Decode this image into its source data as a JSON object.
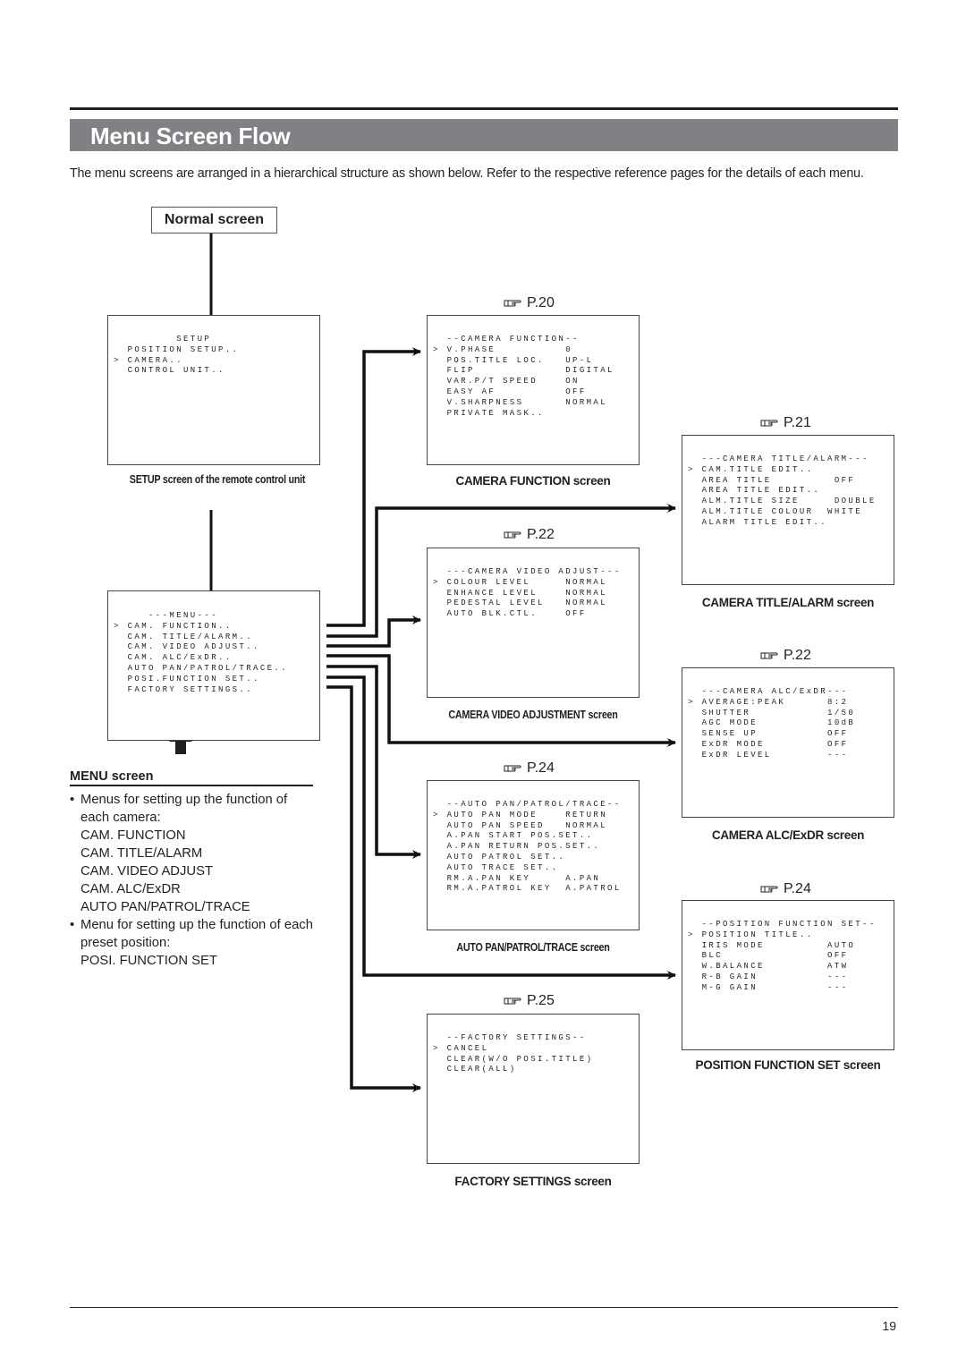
{
  "page": {
    "title": "Menu Screen Flow",
    "intro": "The menu screens are arranged in a hierarchical structure as shown below. Refer to the respective reference pages for the details of each menu.",
    "page_number": "19"
  },
  "normal_screen": {
    "label": "Normal screen"
  },
  "screens": {
    "setup": {
      "caption": "SETUP screen of the remote control unit",
      "text": "         SETUP\n  POSITION SETUP..\n> CAMERA..\n  CONTROL UNIT.."
    },
    "menu": {
      "text": "     ---MENU---\n> CAM. FUNCTION..\n  CAM. TITLE/ALARM..\n  CAM. VIDEO ADJUST..\n  CAM. ALC/ExDR..\n  AUTO PAN/PATROL/TRACE..\n  POSI.FUNCTION SET..\n  FACTORY SETTINGS.."
    },
    "camera_function": {
      "ref": "P.20",
      "caption": "CAMERA FUNCTION screen",
      "text": "  --CAMERA FUNCTION--\n> V.PHASE          0\n  POS.TITLE LOC.   UP-L\n  FLIP             DIGITAL\n  VAR.P/T SPEED    ON\n  EASY AF          OFF\n  V.SHARPNESS      NORMAL\n  PRIVATE MASK.."
    },
    "camera_title_alarm": {
      "ref": "P.21",
      "caption": "CAMERA TITLE/ALARM screen",
      "text": "  ---CAMERA TITLE/ALARM---\n> CAM.TITLE EDIT..\n  AREA TITLE         OFF\n  AREA TITLE EDIT..\n  ALM.TITLE SIZE     DOUBLE\n  ALM.TITLE COLOUR  WHITE\n  ALARM TITLE EDIT.."
    },
    "camera_video_adjust": {
      "ref": "P.22",
      "caption": "CAMERA VIDEO ADJUSTMENT screen",
      "text": "  ---CAMERA VIDEO ADJUST---\n> COLOUR LEVEL     NORMAL\n  ENHANCE LEVEL    NORMAL\n  PEDESTAL LEVEL   NORMAL\n  AUTO BLK.CTL.    OFF"
    },
    "camera_alc_exdr": {
      "ref": "P.22",
      "caption": "CAMERA ALC/ExDR screen",
      "text": "  ---CAMERA ALC/ExDR---\n> AVERAGE:PEAK      8:2\n  SHUTTER           1/50\n  AGC MODE          10dB\n  SENSE UP          OFF\n  ExDR MODE         OFF\n  ExDR LEVEL        ---"
    },
    "auto_pan_patrol_trace": {
      "ref": "P.24",
      "caption": "AUTO PAN/PATROL/TRACE screen",
      "text": "  --AUTO PAN/PATROL/TRACE--\n> AUTO PAN MODE    RETURN\n  AUTO PAN SPEED   NORMAL\n  A.PAN START POS.SET..\n  A.PAN RETURN POS.SET..\n  AUTO PATROL SET..\n  AUTO TRACE SET..\n  RM.A.PAN KEY     A.PAN\n  RM.A.PATROL KEY  A.PATROL"
    },
    "position_function_set": {
      "ref": "P.24",
      "caption": "POSITION FUNCTION SET screen",
      "text": "  --POSITION FUNCTION SET--\n> POSITION TITLE..\n  IRIS MODE         AUTO\n  BLC               OFF\n  W.BALANCE         ATW\n  R-B GAIN          ---\n  M-G GAIN          ---"
    },
    "factory_settings": {
      "ref": "P.25",
      "caption": "FACTORY SETTINGS screen",
      "text": "  --FACTORY SETTINGS--\n> CANCEL\n  CLEAR(W/O POSI.TITLE)\n  CLEAR(ALL)"
    }
  },
  "menu_description": {
    "heading": "MENU screen",
    "bullet1": "Menus for setting up the function of each camera:",
    "camera_items": [
      "CAM. FUNCTION",
      "CAM. TITLE/ALARM",
      "CAM. VIDEO ADJUST",
      "CAM. ALC/ExDR",
      "AUTO PAN/PATROL/TRACE"
    ],
    "bullet2": "Menu for setting up the function of each preset position:",
    "position_items": [
      "POSI. FUNCTION SET"
    ]
  },
  "icons": {
    "reference": "pointing-hand-icon",
    "arrow": "arrow-right-icon",
    "up": "arrow-up-icon"
  },
  "colors": {
    "title_bar": "#808185",
    "text": "#231f20"
  }
}
